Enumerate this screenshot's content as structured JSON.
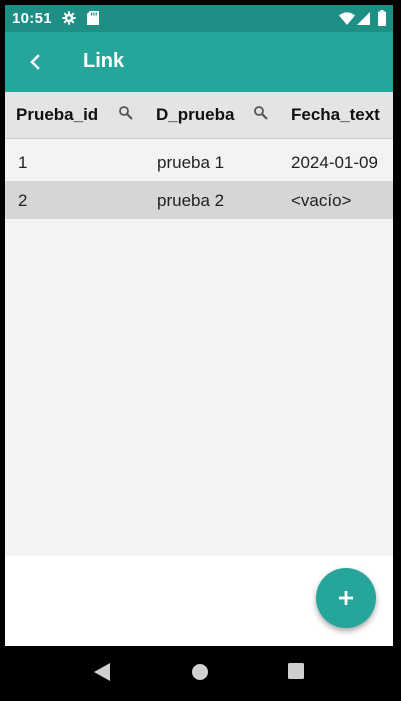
{
  "status_bar": {
    "time": "10:51",
    "icons": [
      "gear-icon",
      "sd-card-icon",
      "wifi-icon",
      "signal-icon",
      "battery-icon"
    ]
  },
  "app_bar": {
    "title": "Link",
    "back_icon": "chevron-left-icon",
    "color": "#26a69a"
  },
  "table": {
    "columns": [
      {
        "label": "Prueba_id",
        "searchable": true
      },
      {
        "label": "D_prueba",
        "searchable": true
      },
      {
        "label": "Fecha_text",
        "searchable": false
      }
    ],
    "rows": [
      [
        "1",
        "prueba 1",
        "2024-01-09"
      ],
      [
        "2",
        "prueba 2",
        "<vacío>"
      ]
    ]
  },
  "fab": {
    "label": "+",
    "icon": "plus-icon"
  },
  "nav_bar": {
    "icons": [
      "back-triangle-icon",
      "home-circle-icon",
      "recents-square-icon"
    ]
  }
}
